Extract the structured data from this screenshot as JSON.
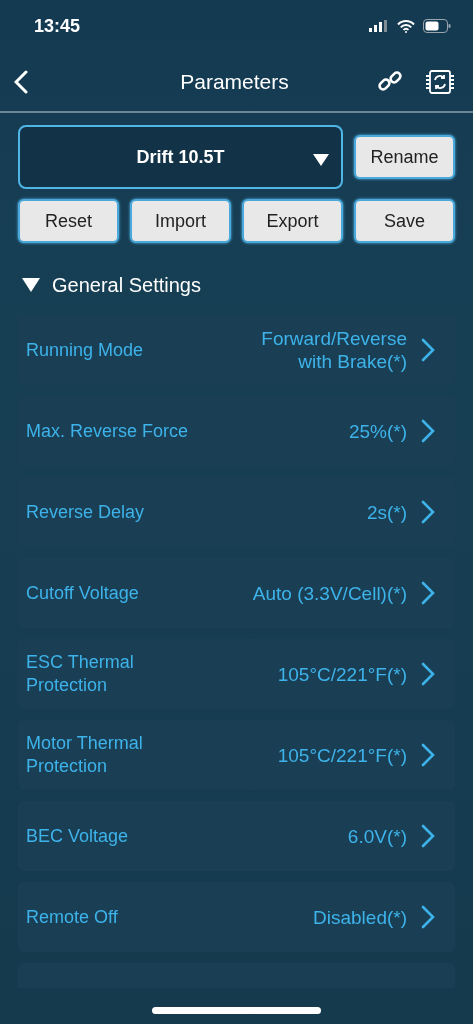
{
  "status_bar": {
    "time": "13:45"
  },
  "nav": {
    "title": "Parameters"
  },
  "profile": {
    "name": "Drift 10.5T",
    "rename": "Rename"
  },
  "actions": [
    "Reset",
    "Import",
    "Export",
    "Save"
  ],
  "section": {
    "title": "General Settings",
    "expanded": true
  },
  "settings": [
    {
      "label": "Running Mode",
      "value": "Forward/Reverse\nwith Brake(*)"
    },
    {
      "label": "Max. Reverse Force",
      "value": "25%(*)"
    },
    {
      "label": "Reverse Delay",
      "value": "2s(*)"
    },
    {
      "label": "Cutoff Voltage",
      "value": "Auto (3.3V/Cell)(*)"
    },
    {
      "label": "ESC Thermal\nProtection",
      "value": "105°C/221°F(*)"
    },
    {
      "label": "Motor Thermal\nProtection",
      "value": "105°C/221°F(*)"
    },
    {
      "label": "BEC Voltage",
      "value": "6.0V(*)"
    },
    {
      "label": "Remote Off",
      "value": "Disabled(*)"
    }
  ]
}
